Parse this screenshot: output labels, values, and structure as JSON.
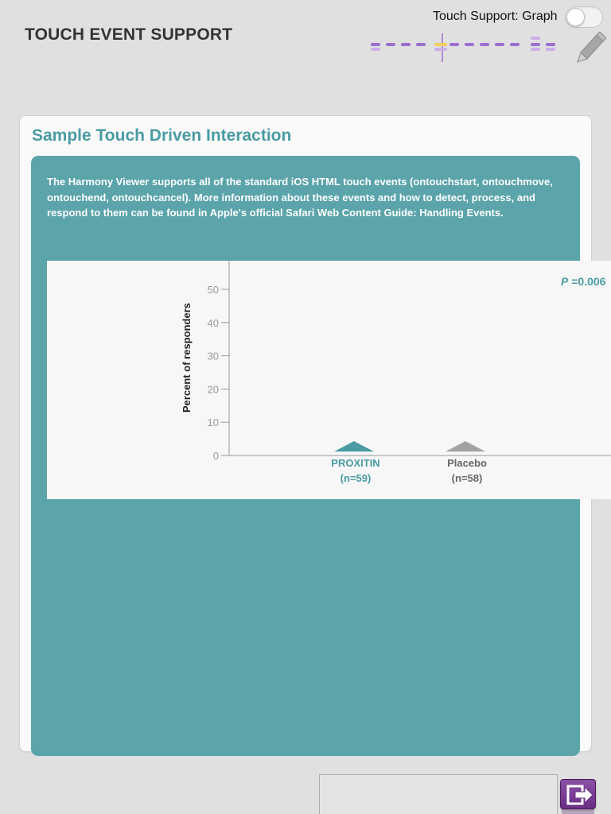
{
  "header": {
    "title": "TOUCH EVENT SUPPORT",
    "toggle_label": "Touch Support: Graph",
    "toggle_on": false
  },
  "card": {
    "title": "Sample Touch Driven Interaction",
    "description": "The Harmony Viewer supports all of the standard iOS HTML touch events (ontouchstart, ontouchmove, ontouchend, ontouchcancel). More information about these events and how to detect, process, and respond to them can be found in Apple's official Safari Web Content Guide: Handling Events."
  },
  "chart_data": {
    "type": "bar",
    "title": "",
    "ylabel": "Percent of responders",
    "xlabel": "",
    "ylim": [
      0,
      55
    ],
    "yticks": [
      0,
      10,
      20,
      30,
      40,
      50
    ],
    "categories": [
      "PROXITIN",
      "Placebo"
    ],
    "category_sublabels": [
      "(n=59)",
      "(n=58)"
    ],
    "values": [
      0,
      0
    ],
    "series_colors": [
      "#4a9ba2",
      "#a3a3a3"
    ],
    "annotation_p_italic": "P",
    "annotation_value": " =0.006",
    "grid": false
  },
  "colors": {
    "accent": "#4a9ba2",
    "panel": "#5aa4aa",
    "timeline": "#9b6fd0",
    "timeline_marker": "#f0d060",
    "exit_button": "#7a3c95"
  },
  "icons": {
    "pencil": "pencil-icon",
    "exit": "exit-icon"
  }
}
